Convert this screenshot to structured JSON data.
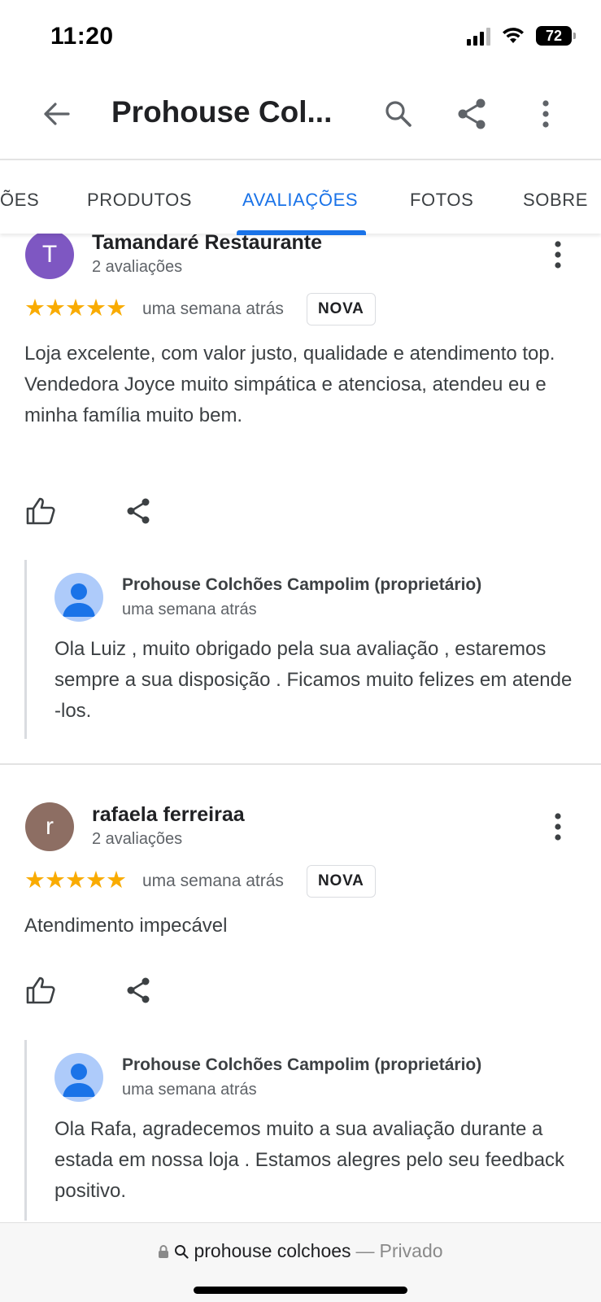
{
  "status_bar": {
    "time": "11:20",
    "battery": "72"
  },
  "app_bar": {
    "title": "Prohouse Col..."
  },
  "tabs": [
    {
      "label": "ÕES"
    },
    {
      "label": "PRODUTOS"
    },
    {
      "label": "AVALIAÇÕES",
      "active": true
    },
    {
      "label": "FOTOS"
    },
    {
      "label": "SOBRE"
    }
  ],
  "reviews": [
    {
      "initial": "T",
      "avatar_color": "#7e57c2",
      "name": "Tamandaré Restaurante",
      "review_count": "2 avaliações",
      "stars": "★★★★★",
      "rating": 5,
      "date": "uma semana atrás",
      "badge": "NOVA",
      "text_line1": "Loja excelente, com valor justo, qualidade e atendimento top.",
      "text_line2": "Vendedora Joyce muito simpática e atenciosa, atendeu eu e minha família muito bem.",
      "reply": {
        "owner": "Prohouse Colchões Campolim (proprietário)",
        "date": "uma semana atrás",
        "text": "Ola Luiz , muito obrigado pela sua avaliação , estaremos sempre a sua disposição . Ficamos muito felizes em atende -los."
      }
    },
    {
      "initial": "r",
      "avatar_color": "#8d6e63",
      "name": "rafaela ferreiraa",
      "review_count": "2 avaliações",
      "stars": "★★★★★",
      "rating": 5,
      "date": "uma semana atrás",
      "badge": "NOVA",
      "text_line1": "Atendimento impecável",
      "reply": {
        "owner": "Prohouse Colchões Campolim (proprietário)",
        "date": "uma semana atrás",
        "text": "Ola Rafa, agradecemos muito a sua avaliação durante a estada em nossa loja . Estamos alegres pelo seu feedback positivo."
      }
    }
  ],
  "url_bar": {
    "query": "prohouse colchoes",
    "separator": "—",
    "mode": "Privado"
  },
  "colors": {
    "accent": "#1a73e8",
    "star": "#f9ab00"
  },
  "icons": [
    "back-arrow-icon",
    "search-icon",
    "share-icon",
    "more-vert-icon",
    "thumbs-up-icon",
    "lock-icon"
  ]
}
